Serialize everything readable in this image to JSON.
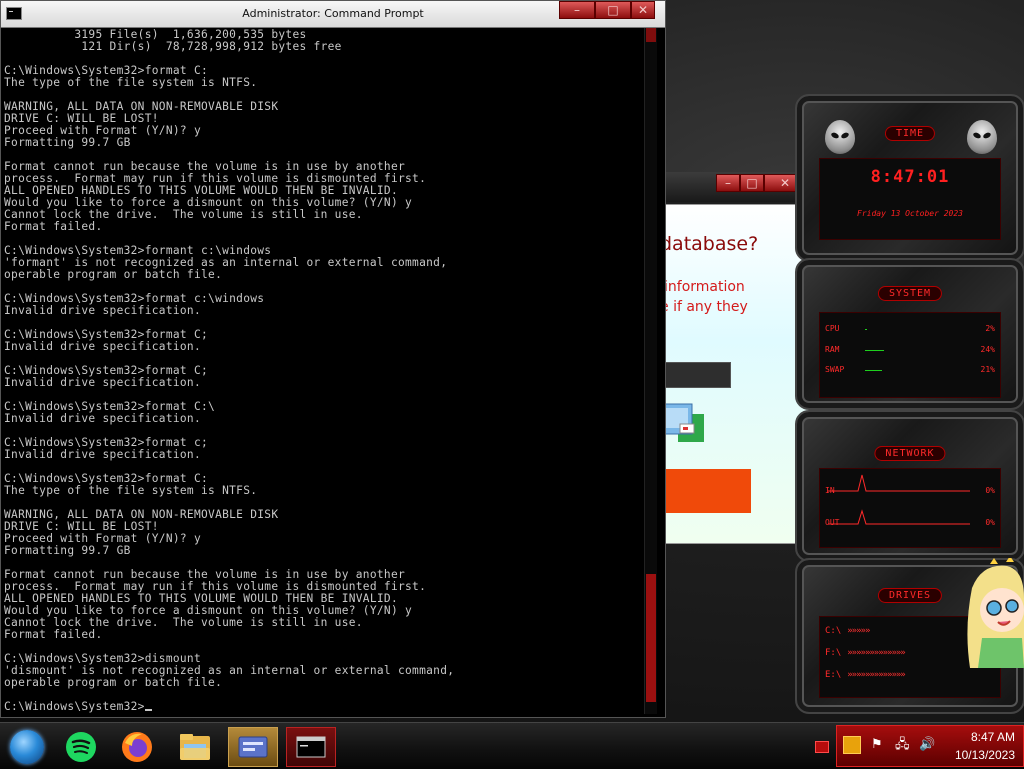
{
  "cmd": {
    "title": "Administrator: Command Prompt",
    "buttons": {
      "minimize": "–",
      "maximize": "□",
      "close": "✕"
    },
    "lines": [
      "          3195 File(s)  1,636,200,535 bytes",
      "           121 Dir(s)  78,728,998,912 bytes free",
      "",
      "C:\\Windows\\System32>format C:",
      "The type of the file system is NTFS.",
      "",
      "WARNING, ALL DATA ON NON-REMOVABLE DISK",
      "DRIVE C: WILL BE LOST!",
      "Proceed with Format (Y/N)? y",
      "Formatting 99.7 GB",
      "",
      "Format cannot run because the volume is in use by another",
      "process.  Format may run if this volume is dismounted first.",
      "ALL OPENED HANDLES TO THIS VOLUME WOULD THEN BE INVALID.",
      "Would you like to force a dismount on this volume? (Y/N) y",
      "Cannot lock the drive.  The volume is still in use.",
      "Format failed.",
      "",
      "C:\\Windows\\System32>formant c:\\windows",
      "'formant' is not recognized as an internal or external command,",
      "operable program or batch file.",
      "",
      "C:\\Windows\\System32>format c:\\windows",
      "Invalid drive specification.",
      "",
      "C:\\Windows\\System32>format C;",
      "Invalid drive specification.",
      "",
      "C:\\Windows\\System32>format C;",
      "Invalid drive specification.",
      "",
      "C:\\Windows\\System32>format C:\\",
      "Invalid drive specification.",
      "",
      "C:\\Windows\\System32>format c;",
      "Invalid drive specification.",
      "",
      "C:\\Windows\\System32>format C:",
      "The type of the file system is NTFS.",
      "",
      "WARNING, ALL DATA ON NON-REMOVABLE DISK",
      "DRIVE C: WILL BE LOST!",
      "Proceed with Format (Y/N)? y",
      "Formatting 99.7 GB",
      "",
      "Format cannot run because the volume is in use by another",
      "process.  Format may run if this volume is dismounted first.",
      "ALL OPENED HANDLES TO THIS VOLUME WOULD THEN BE INVALID.",
      "Would you like to force a dismount on this volume? (Y/N) y",
      "Cannot lock the drive.  The volume is still in use.",
      "Format failed.",
      "",
      "C:\\Windows\\System32>dismount",
      "'dismount' is not recognized as an internal or external command,",
      "operable program or batch file.",
      ""
    ],
    "prompt": "C:\\Windows\\System32>"
  },
  "dialog": {
    "heading": "database?",
    "line1": "information",
    "line2": "e if any they"
  },
  "gadgets": {
    "time": {
      "label": "TIME",
      "clock": "8:47:01",
      "date": "Friday 13 October 2023"
    },
    "system": {
      "label": "SYSTEM",
      "rows": [
        {
          "name": "CPU",
          "value": "2%",
          "level": 0.02
        },
        {
          "name": "RAM",
          "value": "24%",
          "level": 0.24
        },
        {
          "name": "SWAP",
          "value": "21%",
          "level": 0.21
        }
      ]
    },
    "network": {
      "label": "NETWORK",
      "rows": [
        {
          "name": "IN",
          "value": "0%"
        },
        {
          "name": "OUT",
          "value": "0%"
        }
      ]
    },
    "drives": {
      "label": "DRIVES",
      "rows": [
        {
          "name": "C:\\",
          "arrows": "»»»»»"
        },
        {
          "name": "F:\\",
          "arrows": "»»»»»»»»»»»»»"
        },
        {
          "name": "E:\\",
          "arrows": "»»»»»»»»»»»»»"
        }
      ]
    }
  },
  "taskbar": {
    "items": [
      {
        "name": "start-orb"
      },
      {
        "name": "spotify-icon"
      },
      {
        "name": "firefox-icon"
      },
      {
        "name": "file-explorer-icon"
      },
      {
        "name": "control-panel-icon"
      },
      {
        "name": "cmd-icon"
      }
    ],
    "clock": {
      "time": "8:47 AM",
      "date": "10/13/2023"
    }
  },
  "colors": {
    "accent_red": "#b00000",
    "console_text": "#c8c8c8",
    "gadget_text": "#ff2a2a",
    "dialog_button": "#f04a0a"
  }
}
